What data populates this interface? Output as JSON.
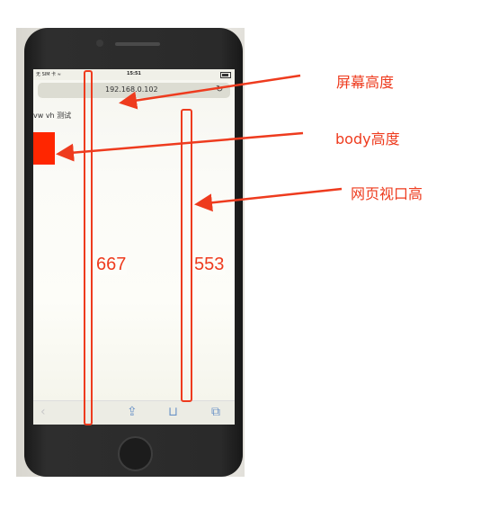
{
  "phone": {
    "status_left": "无 SIM 卡 ≈",
    "status_time": "15:51",
    "url": "192.168.0.102",
    "page_heading": "vw vh 测试"
  },
  "annotations": {
    "screen_height_label": "屏幕高度",
    "body_height_label": "body高度",
    "viewport_height_label": "网页视口高",
    "screen_height_value": "667",
    "viewport_height_value": "553"
  },
  "toolbar": {
    "back_glyph": "‹",
    "share_glyph": "⇪",
    "bookmarks_glyph": "⊔",
    "tabs_glyph": "⧉"
  },
  "colors": {
    "annotation": "#ee3b1e",
    "red_box": "#ff2600",
    "toolbar_icon": "#6b93c7"
  }
}
